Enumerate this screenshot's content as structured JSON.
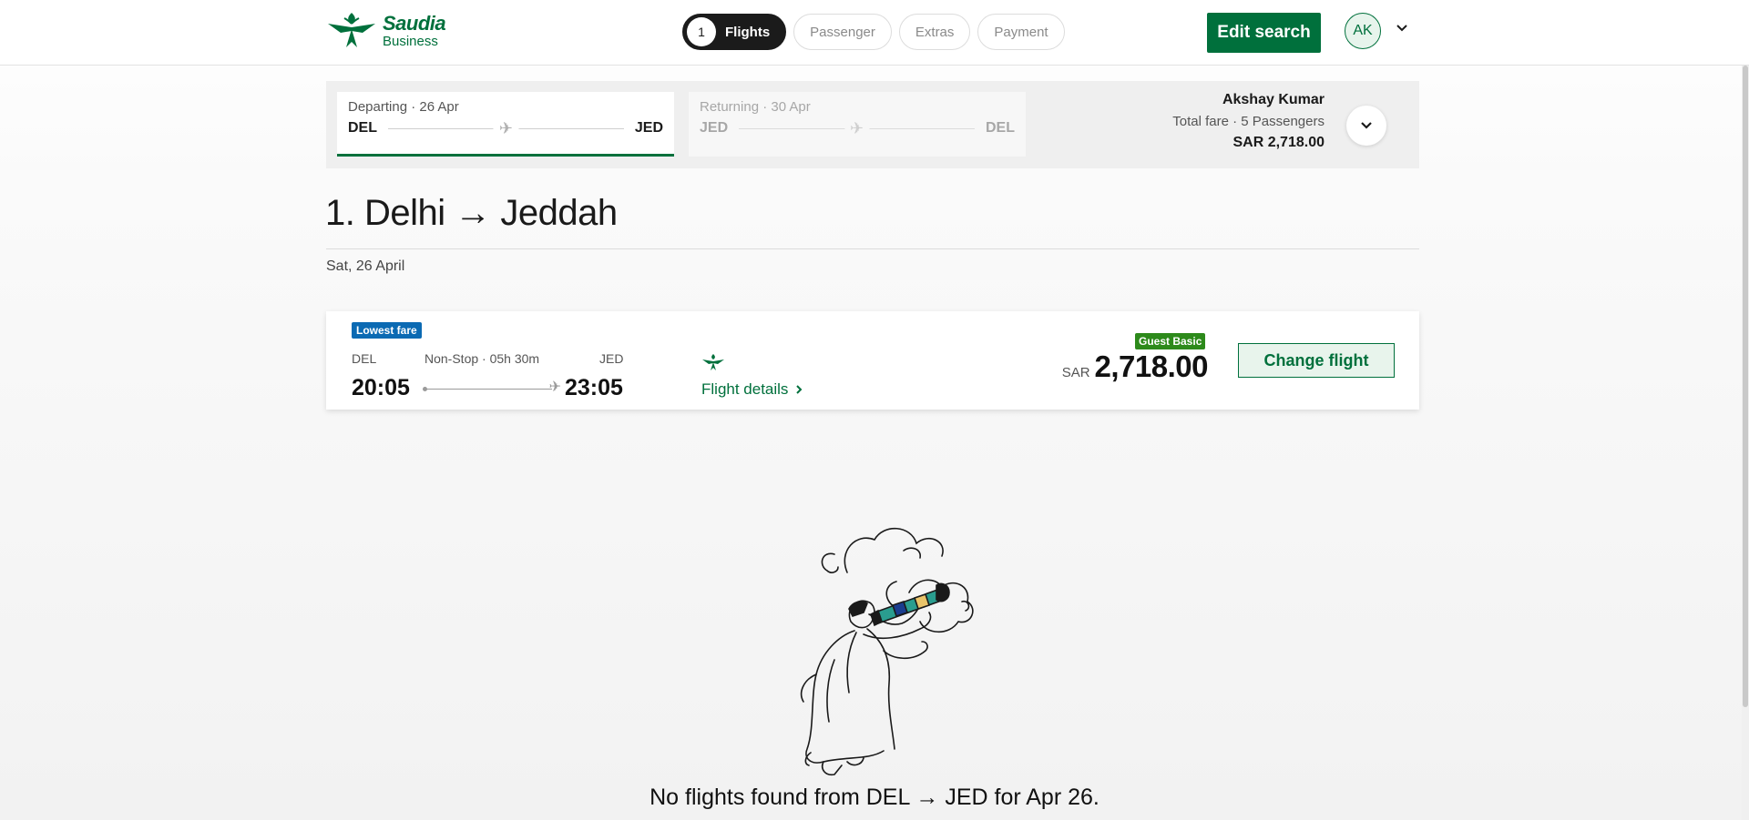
{
  "brand": {
    "name": "Saudia",
    "sub": "Business",
    "color": "#00703c"
  },
  "steps": [
    {
      "num": "1",
      "label": "Flights",
      "active": true
    },
    {
      "label": "Passenger"
    },
    {
      "label": "Extras"
    },
    {
      "label": "Payment"
    }
  ],
  "header": {
    "edit_search": "Edit search",
    "avatar_initials": "AK"
  },
  "trip": {
    "departing": {
      "label": "Departing · 26 Apr",
      "from": "DEL",
      "to": "JED"
    },
    "returning": {
      "label": "Returning · 30 Apr",
      "from": "JED",
      "to": "DEL"
    },
    "passenger_name": "Akshay Kumar",
    "fare_label": "Total fare · 5 Passengers",
    "fare_total": "SAR 2,718.00"
  },
  "heading": {
    "title": "1. Delhi → Jeddah",
    "date": "Sat, 26 April"
  },
  "flight": {
    "badge": "Lowest fare",
    "from_code": "DEL",
    "to_code": "JED",
    "stops": "Non-Stop · 05h 30m",
    "depart_time": "20:05",
    "arrive_time": "23:05",
    "details_link": "Flight details",
    "fare_class": "Guest Basic",
    "currency": "SAR",
    "price": "2,718.00",
    "change_button": "Change flight"
  },
  "empty_state": {
    "message": "No flights found from DEL → JED for Apr 26."
  }
}
